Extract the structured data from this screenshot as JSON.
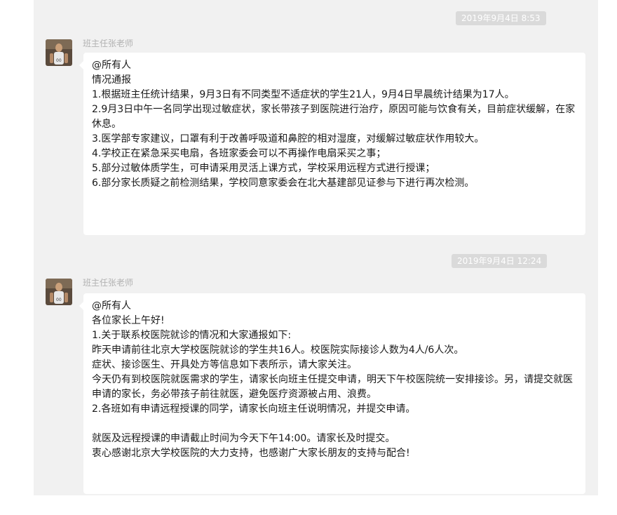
{
  "messages": [
    {
      "timestamp": "2019年9月4日 8:53",
      "sender": "班主任张老师",
      "lines": [
        "@所有人",
        "情况通报",
        "1.根据班主任统计结果，9月3日有不同类型不适症状的学生21人，9月4日早晨统计结果为17人。",
        "2.9月3日中午一名同学出现过敏症状，家长带孩子到医院进行治疗，原因可能与饮食有关，目前症状缓解，在家休息。",
        "3.医学部专家建议，口罩有利于改善呼吸道和鼻腔的相对湿度，对缓解过敏症状作用较大。",
        "4.学校正在紧急采买电扇，各班家委会可以不再操作电扇采买之事；",
        "5.部分过敏体质学生，可申请采用灵活上课方式，学校采用远程方式进行授课；",
        "6.部分家长质疑之前检测结果，学校同意家委会在北大基建部见证参与下进行再次检测。"
      ]
    },
    {
      "timestamp": "2019年9月4日 12:24",
      "sender": "班主任张老师",
      "lines": [
        "@所有人",
        "各位家长上午好!",
        "1.关于联系校医院就诊的情况和大家通报如下:",
        "昨天申请前往北京大学校医院就诊的学生共16人。校医院实际接诊人数为4人/6人次。",
        "症状、接诊医生、开具处方等信息如下表所示，请大家关注。",
        "今天仍有到校医院就医需求的学生，请家长向班主任提交申请，明天下午校医院统一安排接诊。另，请提交就医申请的家长，务必带孩子前往就医，避免医疗资源被占用、浪费。",
        "2.各班如有申请远程授课的同学，请家长向班主任说明情况，并提交申请。",
        "",
        "就医及远程授课的申请截止时间为今天下午14:00。请家长及时提交。",
        "衷心感谢北京大学校医院的大力支持，也感谢广大家长朋友的支持与配合!"
      ]
    }
  ]
}
